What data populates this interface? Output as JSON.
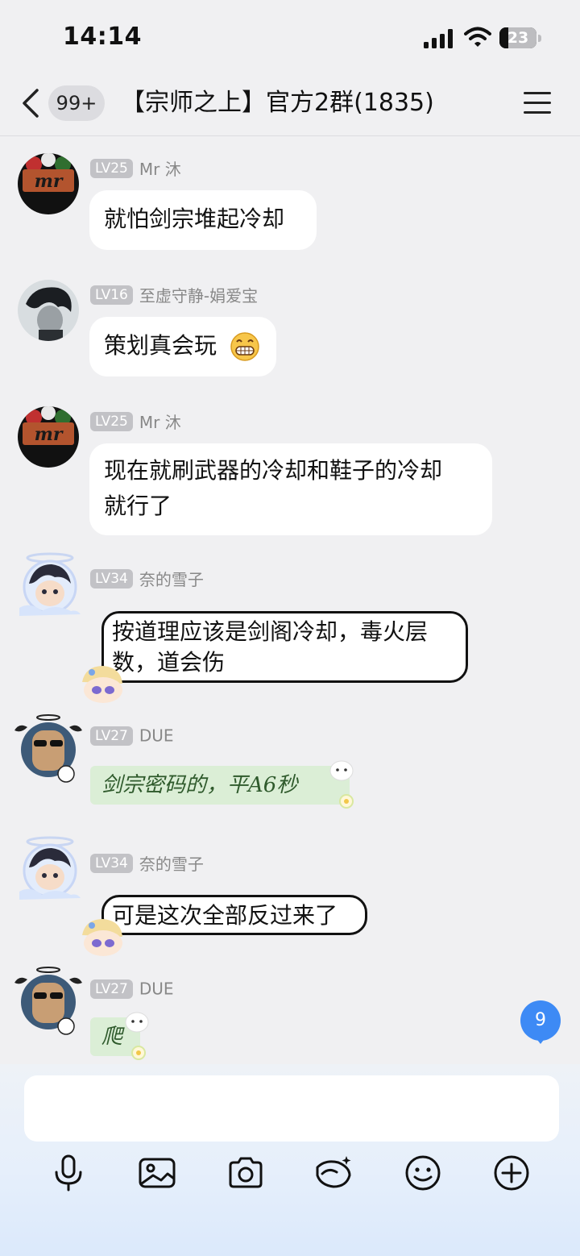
{
  "status_bar": {
    "time": "14:14",
    "battery": "23"
  },
  "nav": {
    "unread_count": "99+",
    "title": "【宗师之上】官方2群(1835)"
  },
  "messages": [
    {
      "level": "LV25",
      "name": "Mr 沐",
      "text": "就怕剑宗堆起冷却"
    },
    {
      "level": "LV16",
      "name": "至虚守静-娟爱宝",
      "text": "策划真会玩"
    },
    {
      "level": "LV25",
      "name": "Mr 沐",
      "text_line1": "现在就刷武器的冷却和鞋子的冷却",
      "text_line2": "就行了"
    },
    {
      "level": "LV34",
      "name": "奈的雪子",
      "text_line1": "按道理应该是剑阁冷却，毒火层",
      "text_line2": "数，道会伤"
    },
    {
      "level": "LV27",
      "name": "DUE",
      "text": "剑宗密码的，平A6秒"
    },
    {
      "level": "LV34",
      "name": "奈的雪子",
      "text": "可是这次全部反过来了"
    },
    {
      "level": "LV27",
      "name": "DUE",
      "text": "爬"
    }
  ],
  "avatar_text": "mr",
  "new_message_badge": "9",
  "input": {
    "placeholder": ""
  },
  "toolbar": [
    "microphone-icon",
    "image-icon",
    "camera-icon",
    "red-packet-icon",
    "emoji-icon",
    "plus-icon"
  ],
  "colors": {
    "accent": "#3d8af5",
    "bubble": "#ffffff",
    "background": "#f0f0f2",
    "green_bubble": "#dbeed6"
  }
}
